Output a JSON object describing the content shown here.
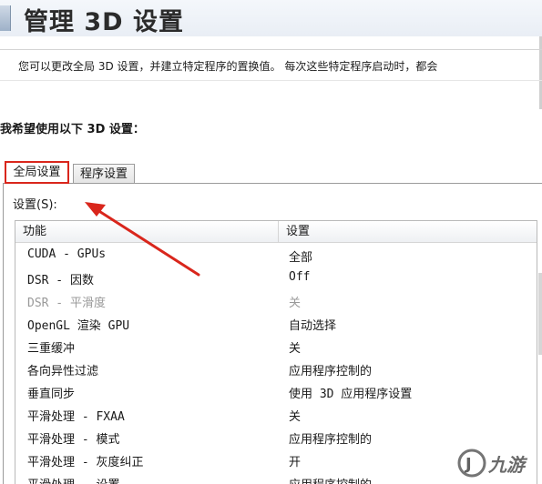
{
  "header": {
    "title": "管理 3D 设置"
  },
  "description": "您可以更改全局 3D 设置，并建立特定程序的置换值。 每次这些特定程序启动时，都会",
  "section_label": "我希望使用以下 3D 设置：",
  "tabs": [
    {
      "label": "全局设置",
      "active": true
    },
    {
      "label": "程序设置",
      "active": false
    }
  ],
  "settings_label": "设置(S):",
  "table": {
    "columns": [
      "功能",
      "设置"
    ],
    "rows": [
      {
        "feature": "CUDA - GPUs",
        "value": "全部",
        "disabled": false
      },
      {
        "feature": "DSR - 因数",
        "value": "Off",
        "disabled": false
      },
      {
        "feature": "DSR - 平滑度",
        "value": "关",
        "disabled": true
      },
      {
        "feature": "OpenGL 渲染 GPU",
        "value": "自动选择",
        "disabled": false
      },
      {
        "feature": "三重缓冲",
        "value": "关",
        "disabled": false
      },
      {
        "feature": "各向异性过滤",
        "value": "应用程序控制的",
        "disabled": false
      },
      {
        "feature": "垂直同步",
        "value": "使用 3D 应用程序设置",
        "disabled": false
      },
      {
        "feature": "平滑处理 - FXAA",
        "value": "关",
        "disabled": false
      },
      {
        "feature": "平滑处理 - 模式",
        "value": "应用程序控制的",
        "disabled": false
      },
      {
        "feature": "平滑处理 - 灰度纠正",
        "value": "开",
        "disabled": false
      },
      {
        "feature": "平滑处理 - 设置",
        "value": "应用程序控制的",
        "disabled": false
      }
    ]
  },
  "watermark": {
    "text": "九游",
    "glyph": "J"
  },
  "colors": {
    "highlight_red": "#d9261c",
    "disabled_text": "#9a9a9a"
  },
  "icons": [
    "nvidia-panel-icon",
    "annotation-arrow-icon",
    "watermark-logo-icon"
  ]
}
